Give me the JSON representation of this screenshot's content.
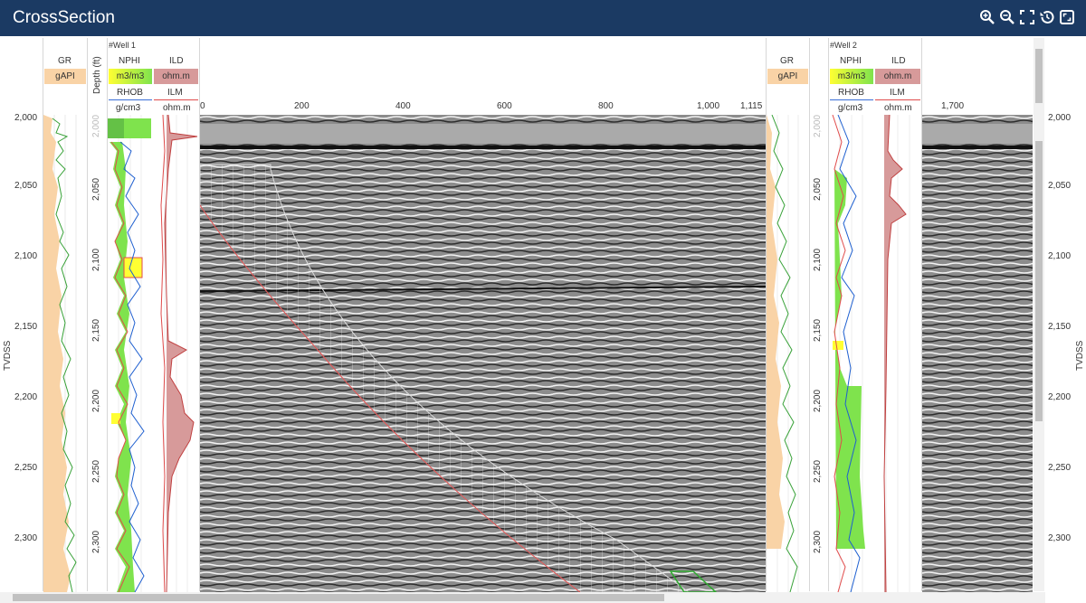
{
  "app": {
    "title": "CrossSection",
    "toolbar": [
      "zoom-in-icon",
      "zoom-out-icon",
      "fit-to-screen-icon",
      "history-icon",
      "fullscreen-icon"
    ]
  },
  "axis": {
    "label": "TVDSS",
    "depths": [
      "2,000",
      "2,050",
      "2,100",
      "2,150",
      "2,200",
      "2,250",
      "2,300"
    ],
    "depth_values": [
      2000,
      2050,
      2100,
      2150,
      2200,
      2250,
      2300
    ]
  },
  "gr_track": {
    "name": "GR",
    "unit": "gAPI",
    "unit_color": "#f9d3a6"
  },
  "well1": {
    "name": "#Well 1",
    "depth_label": "Depth (ft)",
    "nphi": {
      "name": "NPHI",
      "unit": "m3/m3"
    },
    "rhob": {
      "name": "RHOB",
      "unit": "g/cm3"
    },
    "ild": {
      "name": "ILD",
      "unit": "ohm.m",
      "unit_color": "#d79a9a"
    },
    "ilm": {
      "name": "ILM",
      "unit": "ohm.m"
    },
    "depths": [
      "2,000",
      "2,050",
      "2,100",
      "2,150",
      "2,200",
      "2,250",
      "2,300"
    ]
  },
  "well2": {
    "name": "#Well 2",
    "gr": {
      "name": "GR",
      "unit": "gAPI"
    },
    "nphi": {
      "name": "NPHI",
      "unit": "m3/m3"
    },
    "rhob": {
      "name": "RHOB",
      "unit": "g/cm3"
    },
    "ild": {
      "name": "ILD",
      "unit": "ohm.m"
    },
    "ilm": {
      "name": "ILM",
      "unit": "ohm.m"
    },
    "depths": [
      "2,000",
      "2,050",
      "2,100",
      "2,150",
      "2,200",
      "2,250",
      "2,300"
    ]
  },
  "distance_axis": {
    "ticks": [
      "0",
      "200",
      "400",
      "600",
      "800",
      "1,000",
      "1,115"
    ],
    "tick_values": [
      0,
      200,
      400,
      600,
      800,
      1000,
      1115
    ],
    "right_tick": "1,700"
  },
  "colors": {
    "header": "#1b3a63",
    "gr_fill": "#f9d3a6",
    "nphi_fill": "#7fe34d",
    "rhob_fill": "#ffff33",
    "ild_fill": "#d79a9a"
  }
}
